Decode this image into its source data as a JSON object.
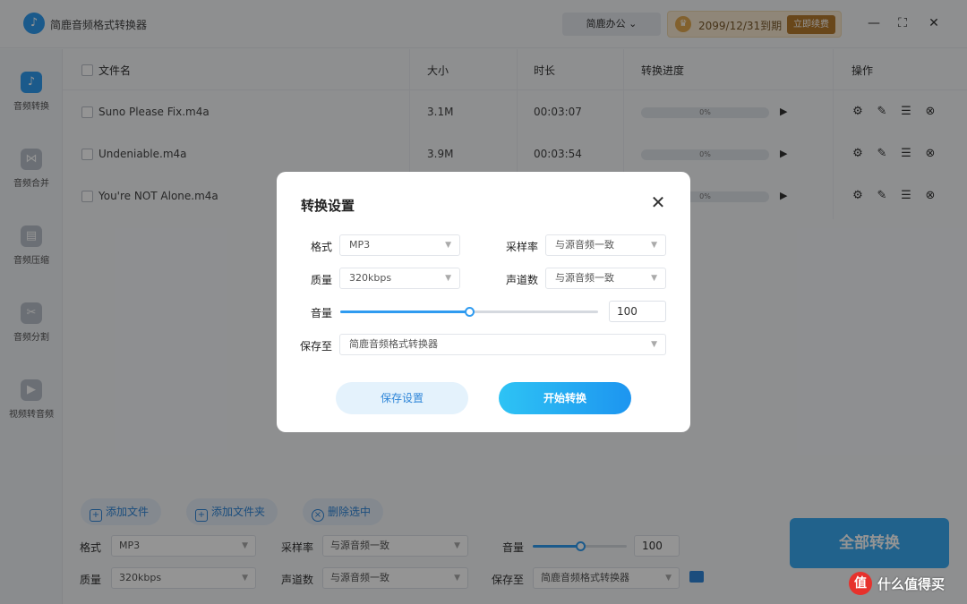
{
  "app": {
    "title": "简鹿音频格式转换器",
    "logo_icon": "music-note-icon"
  },
  "header": {
    "team": "简鹿办公",
    "vip_expiry": "2099/12/31到期",
    "renew_label": "立即续费",
    "window_controls": [
      "minimize-icon",
      "fullscreen-icon",
      "close-icon"
    ]
  },
  "sidebar": {
    "items": [
      {
        "label": "音频转换",
        "icon": "music-icon",
        "active": true
      },
      {
        "label": "音频合并",
        "icon": "merge-icon",
        "active": false
      },
      {
        "label": "音频压缩",
        "icon": "compress-icon",
        "active": false
      },
      {
        "label": "音频分割",
        "icon": "scissors-icon",
        "active": false
      },
      {
        "label": "视频转音频",
        "icon": "video-icon",
        "active": false
      }
    ]
  },
  "table": {
    "headers": {
      "name": "文件名",
      "size": "大小",
      "duration": "时长",
      "progress": "转换进度",
      "actions": "操作"
    },
    "rows": [
      {
        "name": "Suno Please Fix.m4a",
        "size": "3.1M",
        "duration": "00:03:07",
        "progress": "0%"
      },
      {
        "name": "Undeniable.m4a",
        "size": "3.9M",
        "duration": "00:03:54",
        "progress": "0%"
      },
      {
        "name": "You're NOT Alone.m4a",
        "size": "",
        "duration": "",
        "progress": "0%"
      }
    ]
  },
  "bottom": {
    "add_file": "添加文件",
    "add_folder": "添加文件夹",
    "delete_selected": "删除选中",
    "format_label": "格式",
    "format_value": "MP3",
    "samplerate_label": "采样率",
    "samplerate_value": "与源音频一致",
    "volume_label": "音量",
    "volume_value": "100",
    "volume_fraction": 0.5,
    "quality_label": "质量",
    "quality_value": "320kbps",
    "channels_label": "声道数",
    "channels_value": "与源音频一致",
    "saveto_label": "保存至",
    "saveto_value": "简鹿音频格式转换器",
    "convert_all": "全部转换"
  },
  "modal": {
    "title": "转换设置",
    "format_label": "格式",
    "format_value": "MP3",
    "samplerate_label": "采样率",
    "samplerate_value": "与源音频一致",
    "quality_label": "质量",
    "quality_value": "320kbps",
    "channels_label": "声道数",
    "channels_value": "与源音频一致",
    "volume_label": "音量",
    "volume_value": "100",
    "volume_fraction": 0.5,
    "saveto_label": "保存至",
    "saveto_value": "简鹿音频格式转换器",
    "save_settings": "保存设置",
    "start_convert": "开始转换"
  },
  "watermark": {
    "badge": "值",
    "text": "什么值得买"
  },
  "colors": {
    "accent": "#2f9bf0",
    "vip_bg": "#f6e7cf",
    "renew_bg": "#b67a2e"
  }
}
